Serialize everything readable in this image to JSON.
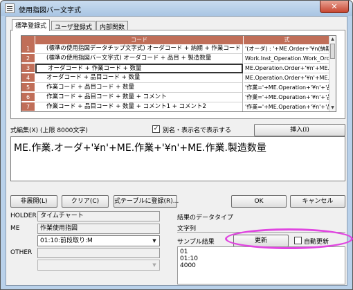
{
  "window": {
    "title": "使用指図バー文字式",
    "close_glyph": "✕"
  },
  "tabs": [
    {
      "label": "標準登録式"
    },
    {
      "label": "ユーザ登録式"
    },
    {
      "label": "内部関数"
    }
  ],
  "grid": {
    "headers": {
      "code": "コード",
      "formula": "式"
    },
    "rows": [
      {
        "num": "1",
        "code": "(標準の使用指図データチップ文字式) オーダコード + 納期 + 作業コード + 数量",
        "formula": "'(オーダ) : '+ME.Order+'¥n(納期"
      },
      {
        "num": "2",
        "code": "(標準の使用指図バー文字式) オーダコード + 品目 + 製造数量",
        "formula": "Work.Inst_Operation.Work_Order+"
      },
      {
        "num": "3",
        "code": "オーダコード + 作業コード + 数量",
        "formula": "ME.Operation.Order+'¥n'+ME.Op"
      },
      {
        "num": "4",
        "code": "オーダコード + 品目コード + 数量",
        "formula": "ME.Operation.Order+'¥n'+ME.Op"
      },
      {
        "num": "5",
        "code": "作業コード + 品目コード + 数量",
        "formula": "'作業='+ME.Operation+'¥n'+'品目"
      },
      {
        "num": "6",
        "code": "作業コード + 品目コード + 数量 + コメント",
        "formula": "'作業='+ME.Operation+'¥n'+'品目"
      },
      {
        "num": "7",
        "code": "作業コード + 品目コード + 数量 + コメント1 + コメント2",
        "formula": "'作業='+ME.Operation+'¥n'+'品目"
      }
    ],
    "selected_row": 3
  },
  "formula_edit": {
    "label": "式編集(X) (上限 8000文字)",
    "alias_checkbox_label": "別名・表示名で表示する",
    "alias_checked": true,
    "insert_button": "挿入(I)",
    "text": "ME.作業.オーダ+'¥n'+ME.作業+'¥n'+ME.作業.製造数量"
  },
  "actions": {
    "hide_button": "非展開(L)",
    "clear_button": "クリア(C)",
    "register_button": "式テーブルに登録(R)...",
    "ok_button": "OK",
    "cancel_button": "キャンセル"
  },
  "holder": {
    "holder_label": "HOLDER",
    "holder_value": "タイムチャート",
    "me_label": "ME",
    "me_value": "作業使用指図",
    "me_combo_value": "01:10:前段取り:M",
    "other_label": "OTHER",
    "other_value": "",
    "other_combo_value": ""
  },
  "result": {
    "type_label": "結果のデータタイプ",
    "type_value": "文字列",
    "sample_label": "サンプル結果",
    "update_button": "更新",
    "auto_update_label": "自動更新",
    "auto_update_checked": false,
    "sample_lines": [
      "01",
      "01:10",
      "4000"
    ]
  },
  "colors": {
    "grid_header": "#c06e58",
    "highlight_ring": "#e046e0"
  }
}
